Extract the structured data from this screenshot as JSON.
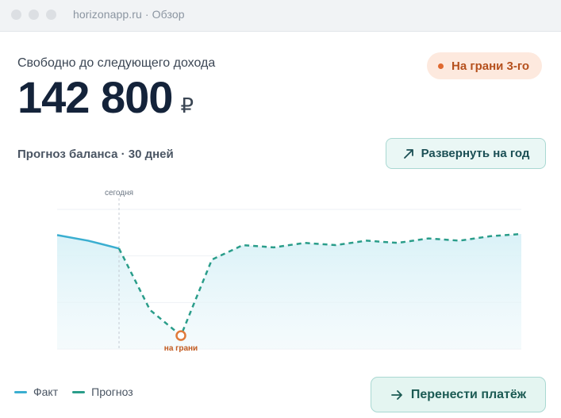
{
  "window": {
    "url": "horizonapp.ru · Обзор"
  },
  "summary": {
    "title": "Свободно до следующего дохода",
    "amount": "142 800",
    "currency": "₽"
  },
  "badge": {
    "label": "На грани 3-го",
    "color": "#e0692f"
  },
  "forecast": {
    "label": "Прогноз баланса · 30 дней"
  },
  "buttons": {
    "expand_label": "Развернуть на год",
    "expand_icon": "arrow-up-right-icon",
    "move_label": "Перенести платёж",
    "move_icon": "arrow-right-icon"
  },
  "legend": {
    "fact": {
      "label": "Факт",
      "color": "#3aaed0"
    },
    "forecast": {
      "label": "Прогноз",
      "color": "#2a9d8a"
    }
  },
  "chart_data": {
    "type": "line",
    "series": [
      {
        "name": "Факт",
        "x": [
          0,
          1,
          2
        ],
        "values": [
          102,
          97,
          90
        ]
      },
      {
        "name": "Прогноз",
        "x": [
          2,
          3,
          4,
          5,
          6,
          7,
          8,
          9,
          10,
          11,
          12,
          13,
          14,
          15
        ],
        "values": [
          90,
          35,
          12,
          80,
          93,
          91,
          95,
          93,
          97,
          95,
          99,
          97,
          101,
          103
        ]
      }
    ],
    "ylim": [
      0,
      125
    ],
    "xlim": [
      0,
      15
    ],
    "grid": true,
    "annotations": [
      {
        "label": "сегодня",
        "x": 2,
        "kind": "vertical-line"
      },
      {
        "label": "на грани",
        "x": 4,
        "y": 12,
        "kind": "marker"
      }
    ]
  }
}
